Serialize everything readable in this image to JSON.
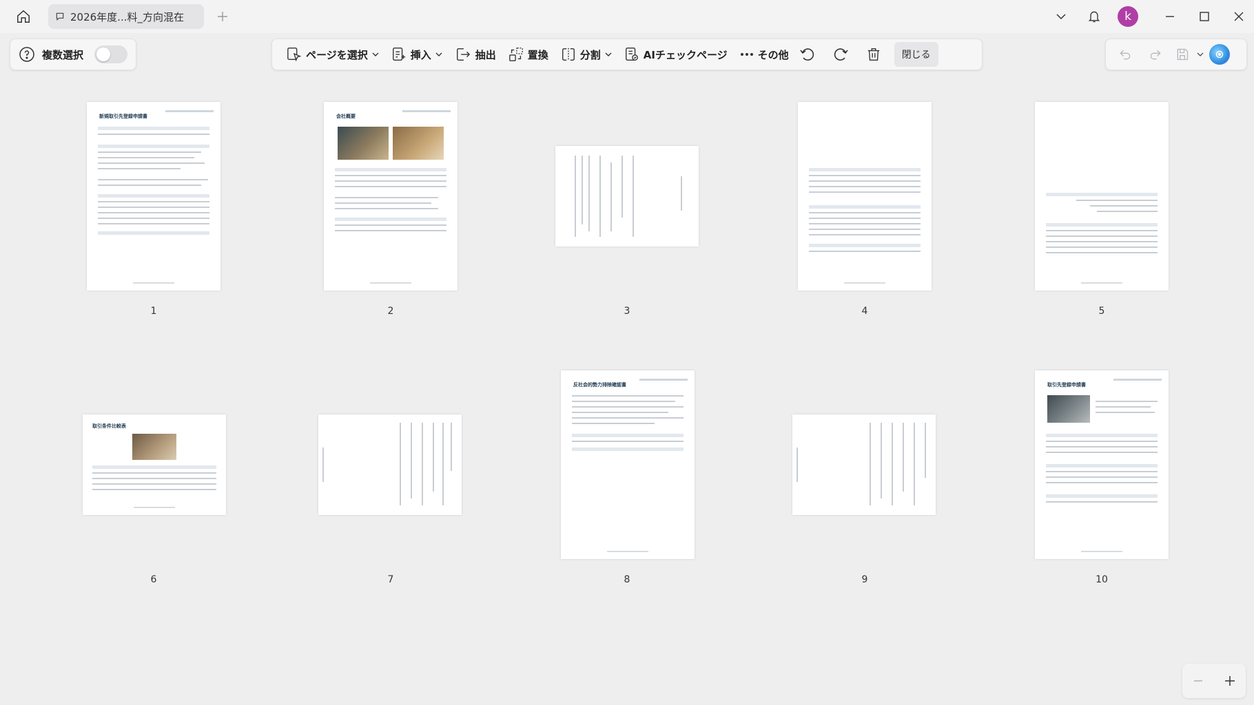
{
  "titlebar": {
    "tab_title": "2026年度...料_方向混在",
    "avatar_letter": "k"
  },
  "toolbar": {
    "multi_select_label": "複数選択",
    "select_page_label": "ページを選択",
    "insert_label": "挿入",
    "extract_label": "抽出",
    "replace_label": "置換",
    "split_label": "分割",
    "ai_check_label": "AIチェックページ",
    "more_label": "その他",
    "close_label": "閉じる"
  },
  "pages": [
    {
      "number": "1",
      "title": "新規取引先登録申請書"
    },
    {
      "number": "2",
      "title": "会社概要"
    },
    {
      "number": "3",
      "title": ""
    },
    {
      "number": "4",
      "title": ""
    },
    {
      "number": "5",
      "title": ""
    },
    {
      "number": "6",
      "title": "取引条件比較表"
    },
    {
      "number": "7",
      "title": ""
    },
    {
      "number": "8",
      "title": "反社会的勢力排除確認書"
    },
    {
      "number": "9",
      "title": ""
    },
    {
      "number": "10",
      "title": "取引先登録申請書"
    }
  ],
  "colors": {
    "accent_avatar": "#b03ea5",
    "ai_badge": "#2b8fe0"
  }
}
